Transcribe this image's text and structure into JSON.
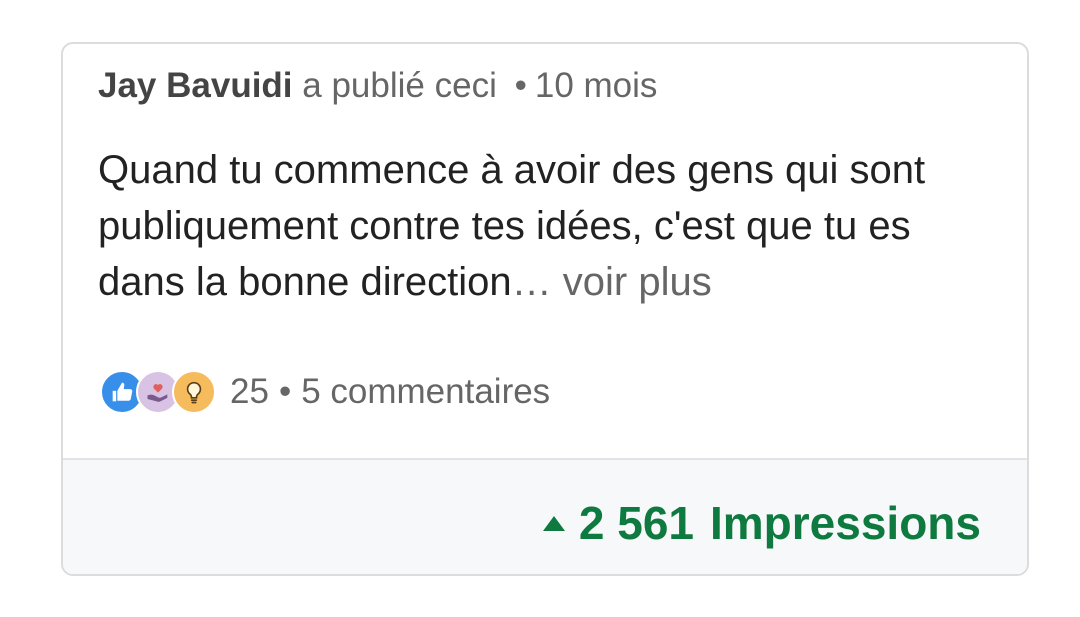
{
  "post": {
    "author": "Jay Bavuidi",
    "action": "a publié ceci",
    "separator": "•",
    "age": "10 mois",
    "body": "Quand tu commence à avoir des gens qui sont publiquement contre tes idées, c'est que tu es dans la bonne direction",
    "ellipsis": "…",
    "see_more": "voir plus"
  },
  "reactions": {
    "icons": [
      "like-icon",
      "love-icon",
      "idea-icon"
    ],
    "colors": {
      "like": "#378fe9",
      "love": "#d8c3e4",
      "idea": "#f5bb5c"
    },
    "count": "25",
    "separator": "•",
    "comments": "5 commentaires"
  },
  "footer": {
    "trend_icon": "triangle-up-icon",
    "impressions_value": "2 561",
    "impressions_label": "Impressions",
    "accent_color": "#0f7a3f",
    "background": "#f6f8fa"
  }
}
